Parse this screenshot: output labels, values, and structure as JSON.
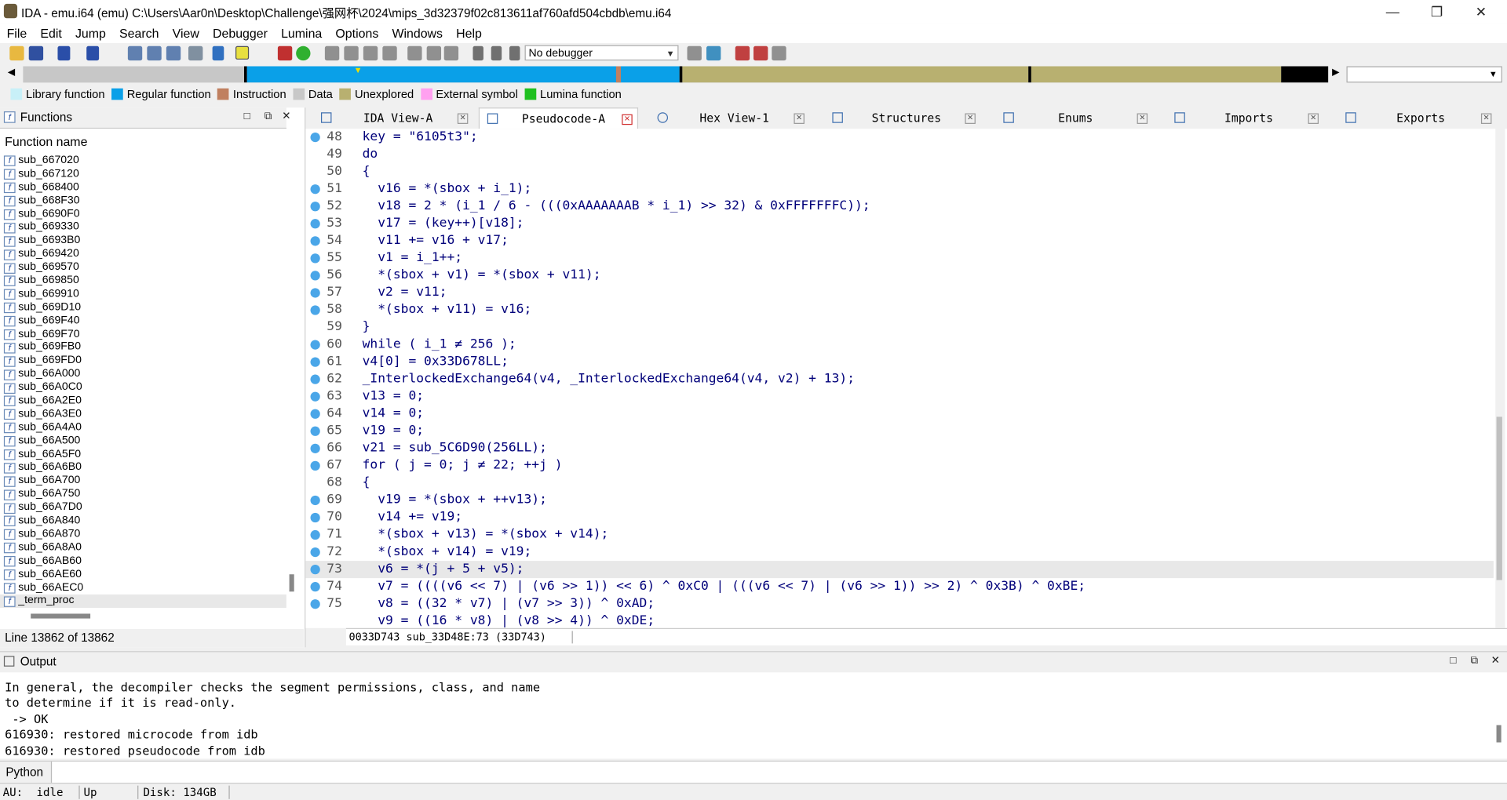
{
  "window": {
    "title": "IDA - emu.i64 (emu) C:\\Users\\Aar0n\\Desktop\\Challenge\\强网杯\\2024\\mips_3d32379f02c813611af760afd504cbdb\\emu.i64"
  },
  "menu": [
    "File",
    "Edit",
    "Jump",
    "Search",
    "View",
    "Debugger",
    "Lumina",
    "Options",
    "Windows",
    "Help"
  ],
  "toolbar": {
    "debugger_select": "No debugger"
  },
  "legend": [
    {
      "label": "Library function",
      "color": "#c8f0f8"
    },
    {
      "label": "Regular function",
      "color": "#0aa0e8"
    },
    {
      "label": "Instruction",
      "color": "#c08060"
    },
    {
      "label": "Data",
      "color": "#c8c8c8"
    },
    {
      "label": "Unexplored",
      "color": "#b8b070"
    },
    {
      "label": "External symbol",
      "color": "#ffa0f0"
    },
    {
      "label": "Lumina function",
      "color": "#20c020"
    }
  ],
  "functions": {
    "title": "Functions",
    "column": "Function name",
    "items": [
      "sub_667020",
      "sub_667120",
      "sub_668400",
      "sub_668F30",
      "sub_6690F0",
      "sub_669330",
      "sub_6693B0",
      "sub_669420",
      "sub_669570",
      "sub_669850",
      "sub_669910",
      "sub_669D10",
      "sub_669F40",
      "sub_669F70",
      "sub_669FB0",
      "sub_669FD0",
      "sub_66A000",
      "sub_66A0C0",
      "sub_66A2E0",
      "sub_66A3E0",
      "sub_66A4A0",
      "sub_66A500",
      "sub_66A5F0",
      "sub_66A6B0",
      "sub_66A700",
      "sub_66A750",
      "sub_66A7D0",
      "sub_66A840",
      "sub_66A870",
      "sub_66A8A0",
      "sub_66AB60",
      "sub_66AE60",
      "sub_66AEC0",
      "_term_proc"
    ],
    "status": "Line 13862 of 13862"
  },
  "tabs": [
    "IDA View-A",
    "Pseudocode-A",
    "Hex View-1",
    "Structures",
    "Enums",
    "Imports",
    "Exports"
  ],
  "code": [
    {
      "n": "48",
      "bp": true,
      "t": "key = \"6105t3\";"
    },
    {
      "n": "49",
      "bp": false,
      "t": "do"
    },
    {
      "n": "50",
      "bp": false,
      "t": "{"
    },
    {
      "n": "51",
      "bp": true,
      "t": "  v16 = *(sbox + i_1);"
    },
    {
      "n": "52",
      "bp": true,
      "t": "  v18 = 2 * (i_1 / 6 - (((0xAAAAAAAB * i_1) >> 32) & 0xFFFFFFFC));"
    },
    {
      "n": "53",
      "bp": true,
      "t": "  v17 = (key++)[v18];"
    },
    {
      "n": "54",
      "bp": true,
      "t": "  v11 += v16 + v17;"
    },
    {
      "n": "55",
      "bp": true,
      "t": "  v1 = i_1++;"
    },
    {
      "n": "56",
      "bp": true,
      "t": "  *(sbox + v1) = *(sbox + v11);"
    },
    {
      "n": "57",
      "bp": true,
      "t": "  v2 = v11;"
    },
    {
      "n": "58",
      "bp": true,
      "t": "  *(sbox + v11) = v16;"
    },
    {
      "n": "59",
      "bp": false,
      "t": "}"
    },
    {
      "n": "60",
      "bp": true,
      "t": "while ( i_1 ≠ 256 );"
    },
    {
      "n": "61",
      "bp": true,
      "t": "v4[0] = 0x33D678LL;"
    },
    {
      "n": "62",
      "bp": true,
      "t": "_InterlockedExchange64(v4, _InterlockedExchange64(v4, v2) + 13);"
    },
    {
      "n": "63",
      "bp": true,
      "t": "v13 = 0;"
    },
    {
      "n": "64",
      "bp": true,
      "t": "v14 = 0;"
    },
    {
      "n": "65",
      "bp": true,
      "t": "v19 = 0;"
    },
    {
      "n": "66",
      "bp": true,
      "t": "v21 = sub_5C6D90(256LL);"
    },
    {
      "n": "67",
      "bp": true,
      "t": "for ( j = 0; j ≠ 22; ++j )"
    },
    {
      "n": "68",
      "bp": false,
      "t": "{"
    },
    {
      "n": "69",
      "bp": true,
      "t": "  v19 = *(sbox + ++v13);"
    },
    {
      "n": "70",
      "bp": true,
      "t": "  v14 += v19;"
    },
    {
      "n": "71",
      "bp": true,
      "t": "  *(sbox + v13) = *(sbox + v14);"
    },
    {
      "n": "72",
      "bp": true,
      "t": "  *(sbox + v14) = v19;"
    },
    {
      "n": "73",
      "bp": true,
      "t": "  v6 = *(j + 5 + v5);"
    },
    {
      "n": "74",
      "bp": true,
      "t": "  v7 = ((((v6 << 7) | (v6 >> 1)) << 6) ^ 0xC0 | (((v6 << 7) | (v6 >> 1)) >> 2) ^ 0x3B) ^ 0xBE;"
    },
    {
      "n": "75",
      "bp": true,
      "t": "  v8 = ((32 * v7) | (v7 >> 3)) ^ 0xAD;"
    },
    {
      "n": "",
      "bp": false,
      "t": "  v9 = ((16 * v8) | (v8 >> 4)) ^ 0xDE;"
    }
  ],
  "address_bar": "0033D743 sub_33D48E:73 (33D743)",
  "output": {
    "title": "Output",
    "lines": [
      "In general, the decompiler checks the segment permissions, class, and name",
      "to determine if it is read-only.",
      " -> OK",
      "616930: restored microcode from idb",
      "616930: restored pseudocode from idb"
    ]
  },
  "python_label": "Python",
  "statusbar": {
    "au_label": "AU:",
    "au_state": "idle",
    "direction": "Up",
    "disk": "Disk: 134GB"
  }
}
